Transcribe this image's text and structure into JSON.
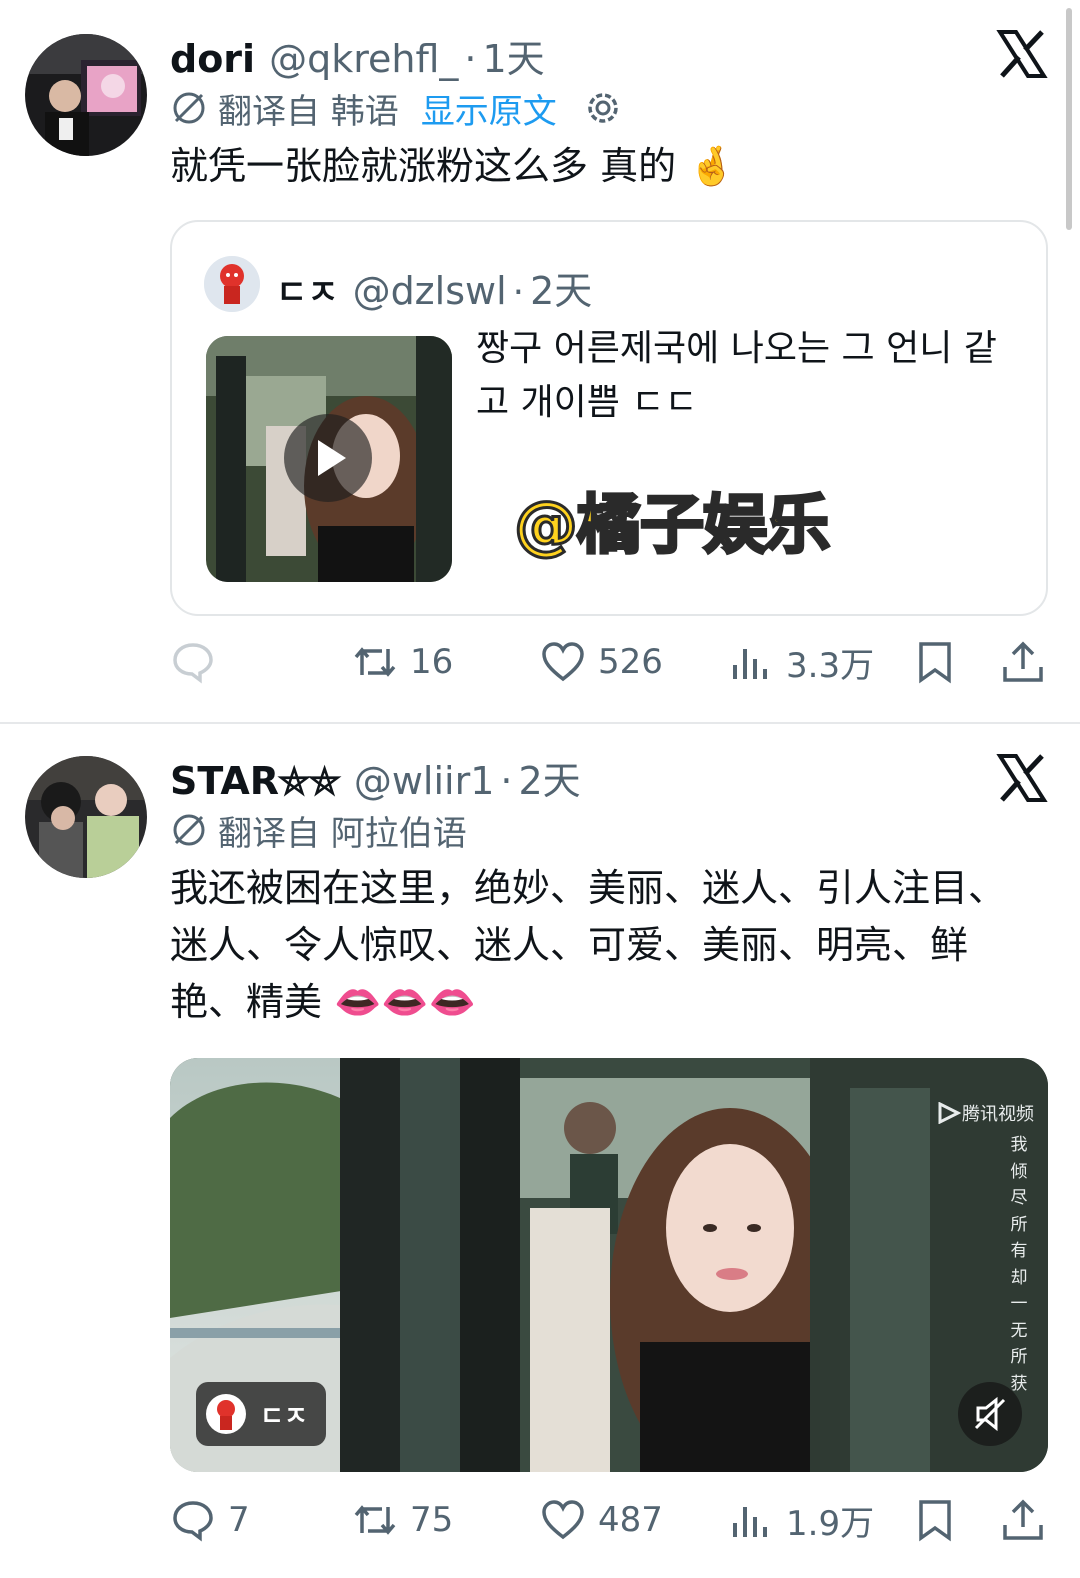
{
  "tweets": [
    {
      "display_name": "dori",
      "handle": "@qkrehfl_",
      "separator": "·",
      "time": "1天",
      "translate_label": "翻译自 韩语",
      "show_original": "显示原文",
      "text": "就凭一张脸就涨粉这么多 真的",
      "emoji": "🤞",
      "quote": {
        "display_name": "ㄷㅈ",
        "handle": "@dzlswl",
        "separator": "·",
        "time": "2天",
        "text": "짱구 어른제국에 나오는 그 언니 같고 개이쁨 ㄷㄷ",
        "watermark": "@橘子娱乐"
      },
      "actions": {
        "replies": "",
        "retweets": "16",
        "likes": "526",
        "views": "3.3万"
      }
    },
    {
      "display_name": "STAR⛤⛤",
      "handle": "@wliir1",
      "separator": "·",
      "time": "2天",
      "translate_label": "翻译自 阿拉伯语",
      "text": "我还被困在这里，绝妙、美丽、迷人、引人注目、迷人、令人惊叹、迷人、可爱、美丽、明亮、鲜艳、精美",
      "emoji": "👄👄👄",
      "media": {
        "tag_label": "ㄷㅈ",
        "tv_logo": "腾讯视频",
        "subtitle_vertical": "我倾尽所有却一无所获"
      },
      "actions": {
        "replies": "7",
        "retweets": "75",
        "likes": "487",
        "views": "1.9万"
      }
    }
  ],
  "colors": {
    "text": "#0f1419",
    "secondary": "#536471",
    "link": "#1d9bf0",
    "border": "#e3e6e8",
    "watermark_fill": "#ffd21e"
  },
  "icons": [
    "x-logo-icon",
    "translate-globe-icon",
    "settings-gear-icon",
    "reply-icon",
    "retweet-icon",
    "like-heart-icon",
    "views-chart-icon",
    "bookmark-icon",
    "share-icon",
    "play-icon",
    "mute-icon"
  ]
}
